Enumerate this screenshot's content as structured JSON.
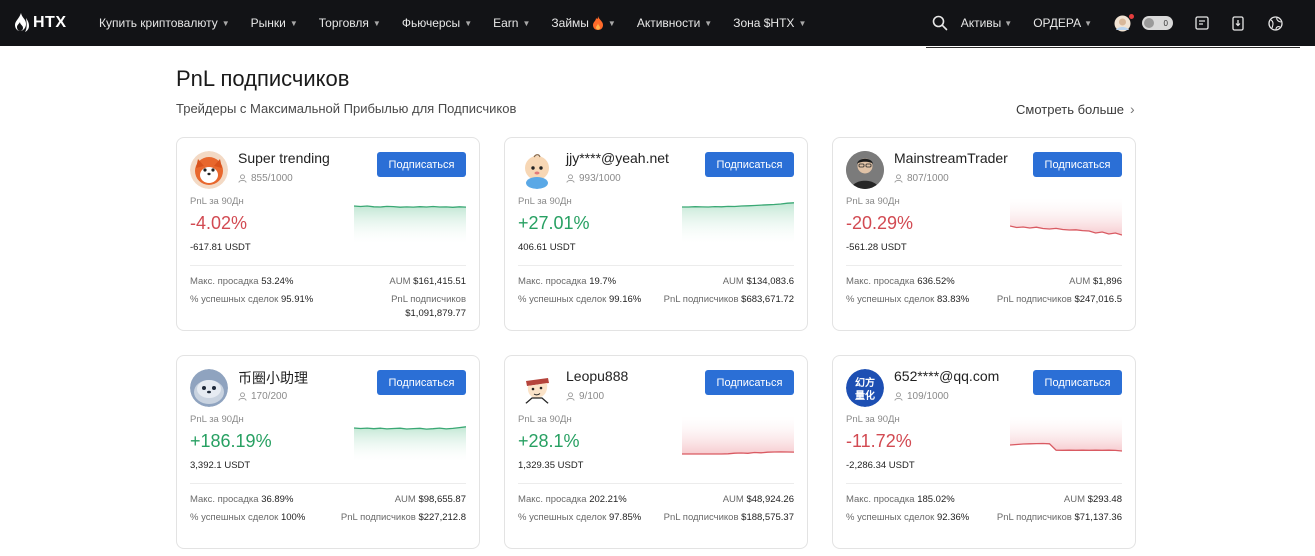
{
  "nav": {
    "logo": "HTX",
    "items": [
      {
        "label": "Купить криптовалюту",
        "caret": true
      },
      {
        "label": "Рынки",
        "caret": true
      },
      {
        "label": "Торговля",
        "caret": true
      },
      {
        "label": "Фьючерсы",
        "caret": true
      },
      {
        "label": "Earn",
        "caret": true
      },
      {
        "label": "Займы",
        "caret": true,
        "badge": "fire"
      },
      {
        "label": "Активности",
        "caret": true
      },
      {
        "label": "Зона $HTX",
        "caret": true
      }
    ],
    "right": {
      "assets": "Активы",
      "orders": "ОРДЕРА",
      "toggle_count": "0"
    }
  },
  "section": {
    "title": "PnL подписчиков",
    "subtitle": "Трейдеры с Максимальной Прибылью для Подписчиков",
    "see_more": "Смотреть больше"
  },
  "labels": {
    "pnl_90d": "PnL за 90Дн",
    "max_drawdown": "Макс. просадка",
    "win_rate": "% успешных сделок",
    "aum": "AUM",
    "follower_pnl": "PnL подписчиков",
    "subscribe": "Подписаться"
  },
  "cards": [
    {
      "name": "Super trending",
      "followers": "855/1000",
      "pnl_pct": "-4.02%",
      "pnl_usdt": "-617.81 USDT",
      "trend": "neg",
      "chart_color": "pos",
      "max_dd": "53.24%",
      "win": "95.91%",
      "aum": "$161,415.51",
      "f_pnl": "$1,091,879.77",
      "avatar": "fox-avatar"
    },
    {
      "name": "jjy****@yeah.net",
      "followers": "993/1000",
      "pnl_pct": "+27.01%",
      "pnl_usdt": "406.61 USDT",
      "trend": "pos",
      "chart_color": "pos",
      "max_dd": "19.7%",
      "win": "99.16%",
      "aum": "$134,083.6",
      "f_pnl": "$683,671.72",
      "avatar": "baby-avatar"
    },
    {
      "name": "MainstreamTrader",
      "followers": "807/1000",
      "pnl_pct": "-20.29%",
      "pnl_usdt": "-561.28 USDT",
      "trend": "neg",
      "chart_color": "neg",
      "max_dd": "636.52%",
      "win": "83.83%",
      "aum": "$1,896",
      "f_pnl": "$247,016.5",
      "avatar": "man-photo-avatar"
    },
    {
      "name": "币圈小助理",
      "followers": "170/200",
      "pnl_pct": "+186.19%",
      "pnl_usdt": "3,392.1 USDT",
      "trend": "pos",
      "chart_color": "pos",
      "max_dd": "36.89%",
      "win": "100%",
      "aum": "$98,655.87",
      "f_pnl": "$227,212.8",
      "avatar": "seal-avatar"
    },
    {
      "name": "Leopu888",
      "followers": "9/100",
      "pnl_pct": "+28.1%",
      "pnl_usdt": "1,329.35 USDT",
      "trend": "pos",
      "chart_color": "neg",
      "max_dd": "202.21%",
      "win": "97.85%",
      "aum": "$48,924.26",
      "f_pnl": "$188,575.37",
      "avatar": "cartoon-man-avatar"
    },
    {
      "name": "652****@qq.com",
      "followers": "109/1000",
      "pnl_pct": "-11.72%",
      "pnl_usdt": "-2,286.34 USDT",
      "trend": "neg",
      "chart_color": "neg",
      "max_dd": "185.02%",
      "win": "92.36%",
      "aum": "$293.48",
      "f_pnl": "$71,137.36",
      "avatar": "quant-logo-avatar",
      "avatar_text": "幻方量化"
    }
  ],
  "colors": {
    "nav_bg": "#121316",
    "button_blue": "#2b6fd6",
    "positive": "#27a062",
    "negative": "#d24a52"
  }
}
